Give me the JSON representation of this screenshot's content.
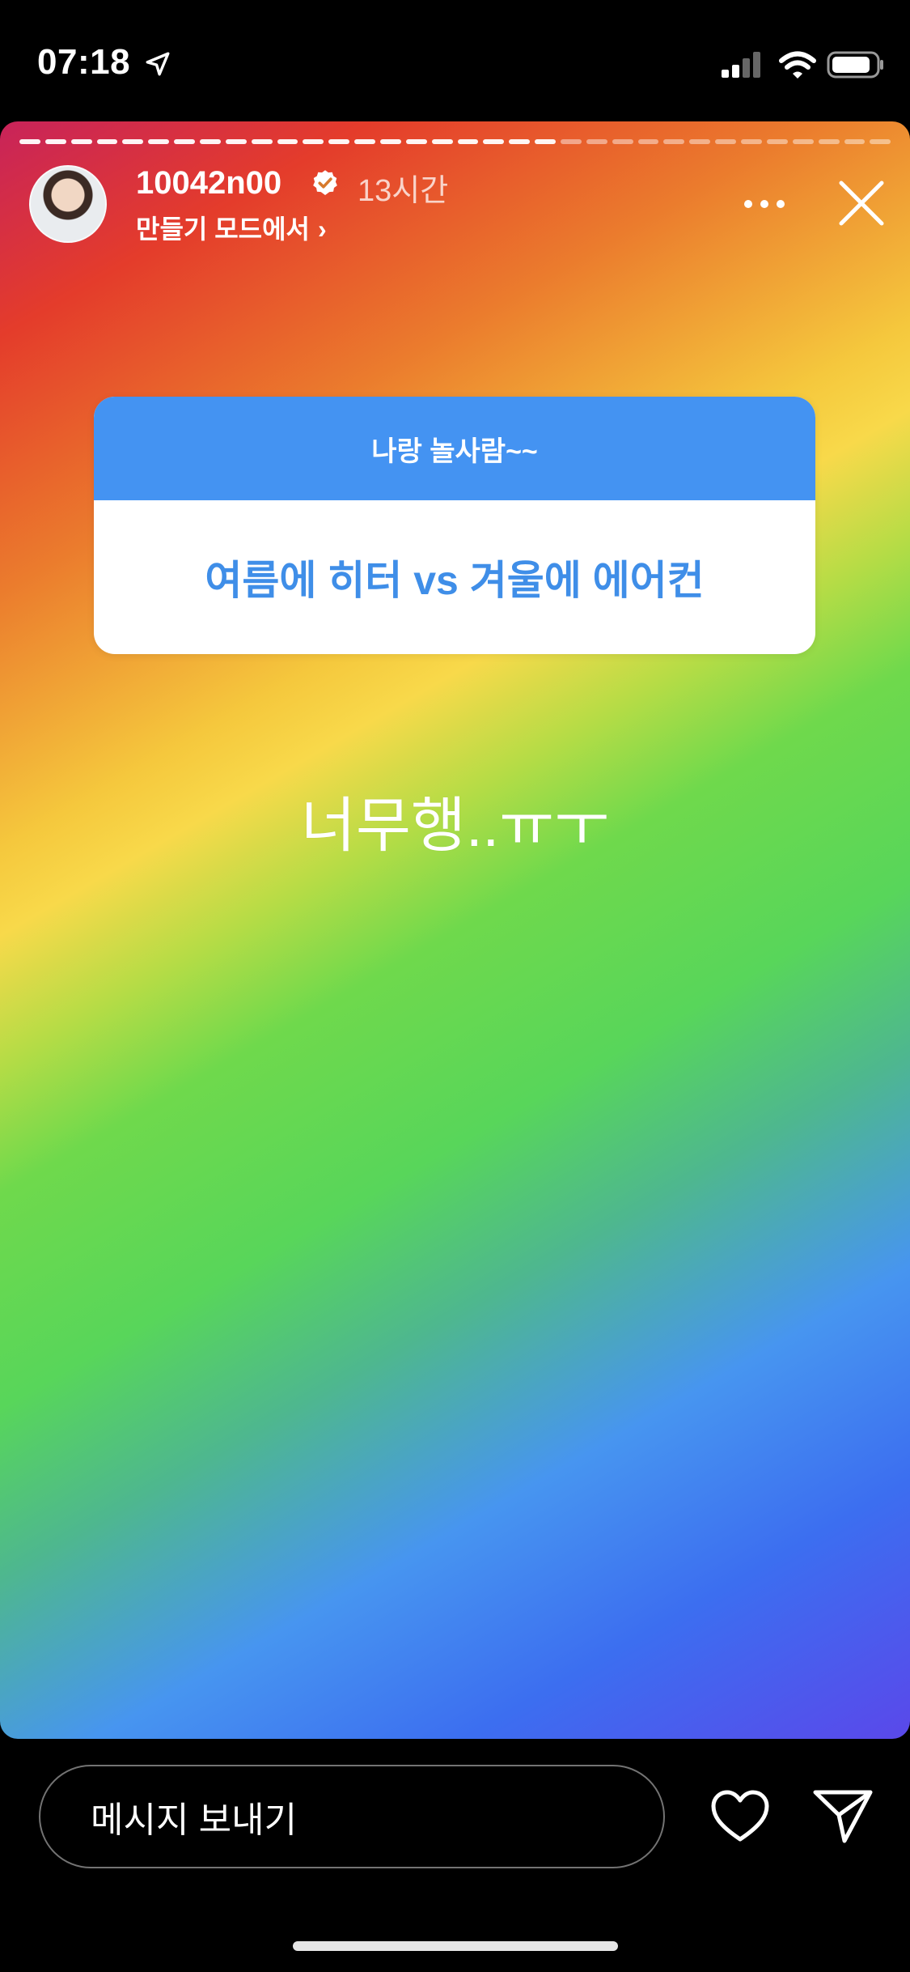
{
  "status_bar": {
    "time": "07:18"
  },
  "story": {
    "progress": {
      "total_segments": 34,
      "completed_segments": 21
    },
    "header": {
      "username": "10042n00",
      "time_ago": "13시간",
      "subtitle": "만들기 모드에서",
      "subtitle_chevron": "›"
    },
    "sticker": {
      "header_text": "나랑 놀사람~~",
      "question": "여름에 히터 vs 겨울에 에어컨"
    },
    "answer_text": "너무행..ㅠㅜ"
  },
  "bottom_bar": {
    "message_placeholder": "메시지 보내기"
  },
  "icons": {
    "location": "location-arrow-icon",
    "signal": "cellular-signal-icon",
    "wifi": "wifi-icon",
    "battery": "battery-icon",
    "verified": "verified-badge-icon",
    "more": "more-options-icon",
    "close": "close-icon",
    "like": "heart-icon",
    "send": "send-icon"
  }
}
